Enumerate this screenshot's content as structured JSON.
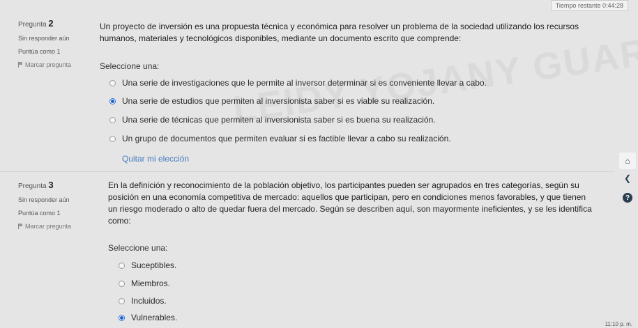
{
  "timer": {
    "label": "Tiempo restante 0:44:28"
  },
  "watermark": "LEIDY YOJANY GUARAN ROBLES",
  "questions": [
    {
      "number_prefix": "Pregunta",
      "number": "2",
      "status": "Sin responder aún",
      "score": "Puntúa como 1",
      "flag_label": "Marcar pregunta",
      "text": "Un proyecto de inversión es una propuesta técnica y económica para resolver un problema de la sociedad utilizando los recursos humanos, materiales y tecnológicos disponibles, mediante un documento escrito que comprende:",
      "select_label": "Seleccione una:",
      "options": [
        {
          "label": "Una serie de investigaciones que le permite al inversor determinar si es conveniente llevar a cabo.",
          "checked": false
        },
        {
          "label": "Una serie de estudios que permiten al inversionista saber si es viable su realización.",
          "checked": true
        },
        {
          "label": "Una serie de técnicas que permiten al inversionista saber si es buena su realización.",
          "checked": false
        },
        {
          "label": "Un grupo de documentos que permiten evaluar si es factible llevar a cabo su realización.",
          "checked": false
        }
      ],
      "clear_label": "Quitar mi elección"
    },
    {
      "number_prefix": "Pregunta",
      "number": "3",
      "status": "Sin responder aún",
      "score": "Puntúa como 1",
      "flag_label": "Marcar pregunta",
      "text": "En la definición y reconocimiento de la población objetivo, los participantes pueden ser agrupados en tres categorías, según su posición en una economía competitiva de mercado: aquellos que participan, pero en condiciones menos favorables, y que tienen un riesgo moderado o alto de quedar fuera del mercado. Según se describen aquí, son mayormente ineficientes, y se les identifica como:",
      "select_label": "Seleccione una:",
      "options": [
        {
          "label": "Suceptibles.",
          "checked": false
        },
        {
          "label": "Miembros.",
          "checked": false
        },
        {
          "label": "Incluidos.",
          "checked": false
        },
        {
          "label": "Vulnerables.",
          "checked": true
        }
      ]
    }
  ],
  "side": {
    "home_icon": "home-icon",
    "back_icon": "arrow-left-icon",
    "help_icon": "help-icon",
    "help_label": "?"
  },
  "clock": "11:10 p. m."
}
